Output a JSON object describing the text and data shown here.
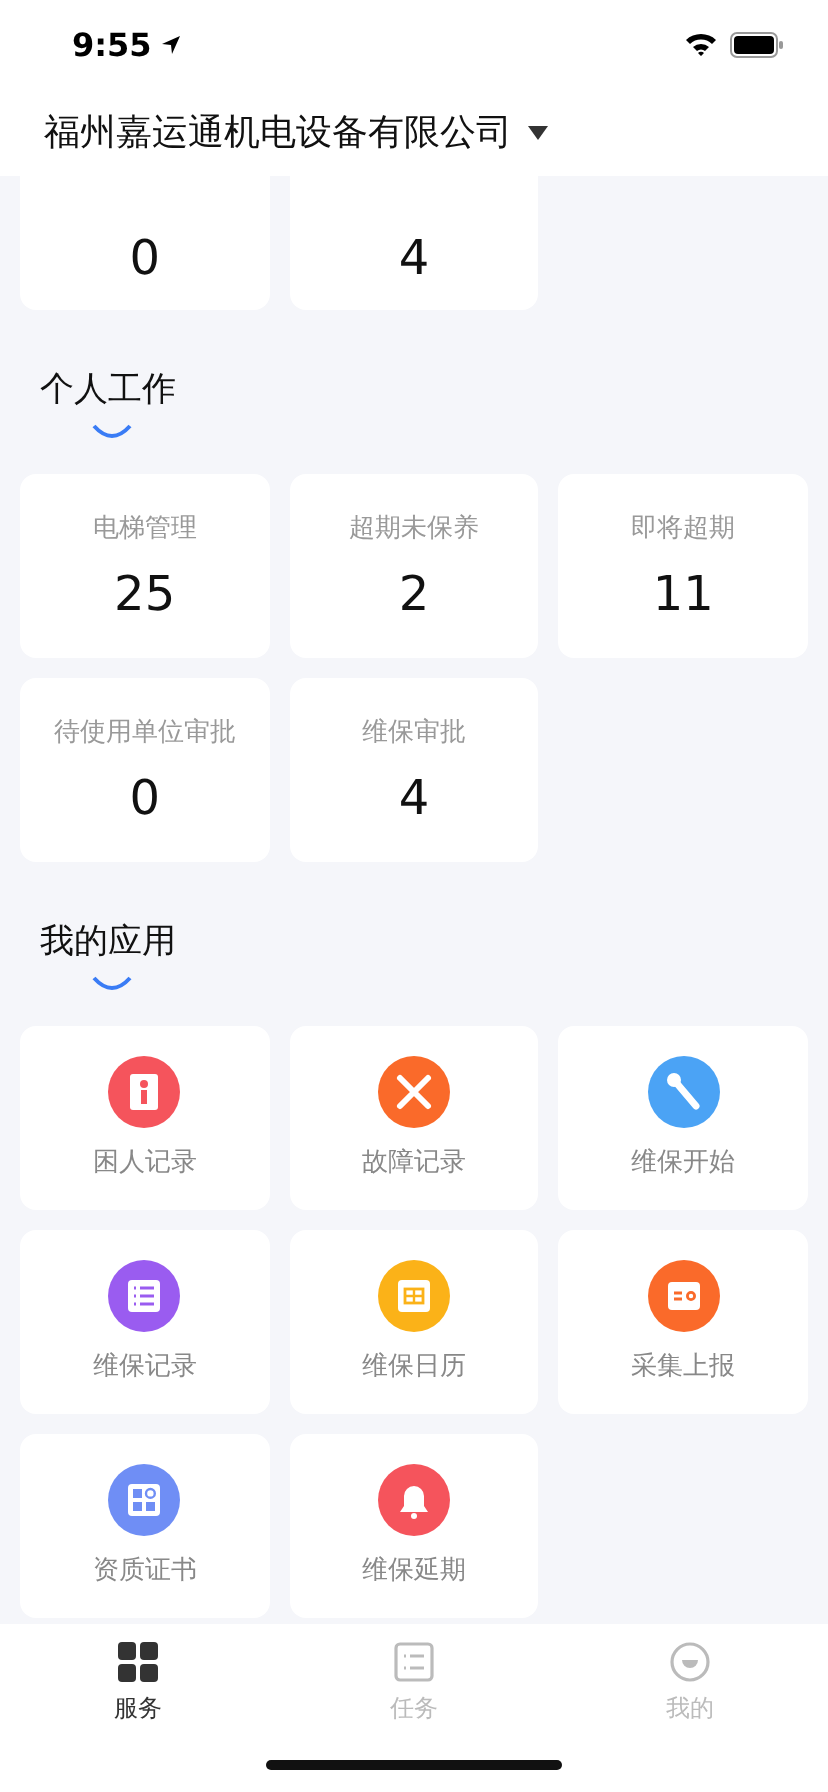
{
  "status_bar": {
    "time": "9:55"
  },
  "header": {
    "company": "福州嘉运通机电设备有限公司"
  },
  "top_partial_cards": [
    {
      "value": "0"
    },
    {
      "value": "4"
    }
  ],
  "personal_work": {
    "title": "个人工作",
    "cards": [
      {
        "label": "电梯管理",
        "value": "25"
      },
      {
        "label": "超期未保养",
        "value": "2"
      },
      {
        "label": "即将超期",
        "value": "11"
      },
      {
        "label": "待使用单位审批",
        "value": "0"
      },
      {
        "label": "维保审批",
        "value": "4"
      }
    ]
  },
  "my_apps": {
    "title": "我的应用",
    "apps": [
      {
        "label": "困人记录",
        "kind": "person",
        "color": "#f5545c"
      },
      {
        "label": "故障记录",
        "kind": "tools",
        "color": "#fa6a2a"
      },
      {
        "label": "维保开始",
        "kind": "wrench",
        "color": "#4ba3f5"
      },
      {
        "label": "维保记录",
        "kind": "list",
        "color": "#9a5cf0"
      },
      {
        "label": "维保日历",
        "kind": "calendar",
        "color": "#fbb218"
      },
      {
        "label": "采集上报",
        "kind": "report",
        "color": "#fa6a2a"
      },
      {
        "label": "资质证书",
        "kind": "grid",
        "color": "#6f8ef5"
      },
      {
        "label": "维保延期",
        "kind": "bell",
        "color": "#f5545c"
      }
    ]
  },
  "tab_bar": [
    {
      "label": "服务",
      "kind": "grid",
      "selected": true
    },
    {
      "label": "任务",
      "kind": "list",
      "selected": false
    },
    {
      "label": "我的",
      "kind": "face",
      "selected": false
    }
  ]
}
